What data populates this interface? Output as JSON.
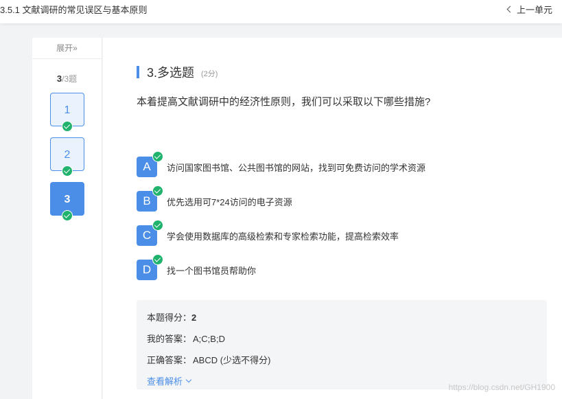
{
  "header": {
    "title": "3.5.1 文献调研的常见误区与基本原则",
    "prev_unit": "上一单元"
  },
  "sidebar": {
    "expand_label": "展开»",
    "counter_current": "3",
    "counter_total": "/3题",
    "questions": [
      {
        "label": "1",
        "answered": true
      },
      {
        "label": "2",
        "answered": true
      },
      {
        "label": "3",
        "answered": true,
        "active": true
      }
    ]
  },
  "question": {
    "title": "3.多选题",
    "score": "(2分)",
    "stem": "本着提高文献调研中的经济性原则，我们可以采取以下哪些措施?",
    "options": [
      {
        "letter": "A",
        "text": "访问国家图书馆、公共图书馆的网站，找到可免费访问的学术资源",
        "selected": true
      },
      {
        "letter": "B",
        "text": "优先选用可7*24访问的电子资源",
        "selected": true
      },
      {
        "letter": "C",
        "text": "学会使用数据库的高级检索和专家检索功能，提高检索效率",
        "selected": true
      },
      {
        "letter": "D",
        "text": "找一个图书馆员帮助你",
        "selected": true
      }
    ]
  },
  "answer": {
    "score_label": "本题得分：",
    "score_value": "2",
    "my_answer_label": "我的答案：",
    "my_answer_value": "A;C;B;D",
    "correct_label": "正确答案：",
    "correct_value": "ABCD (少选不得分)",
    "analysis_link": "查看解析"
  },
  "watermark": "https://blog.csdn.net/GH1900",
  "colors": {
    "accent": "#4a8ee8",
    "check": "#21b36e",
    "panel": "#f4f5f7"
  }
}
